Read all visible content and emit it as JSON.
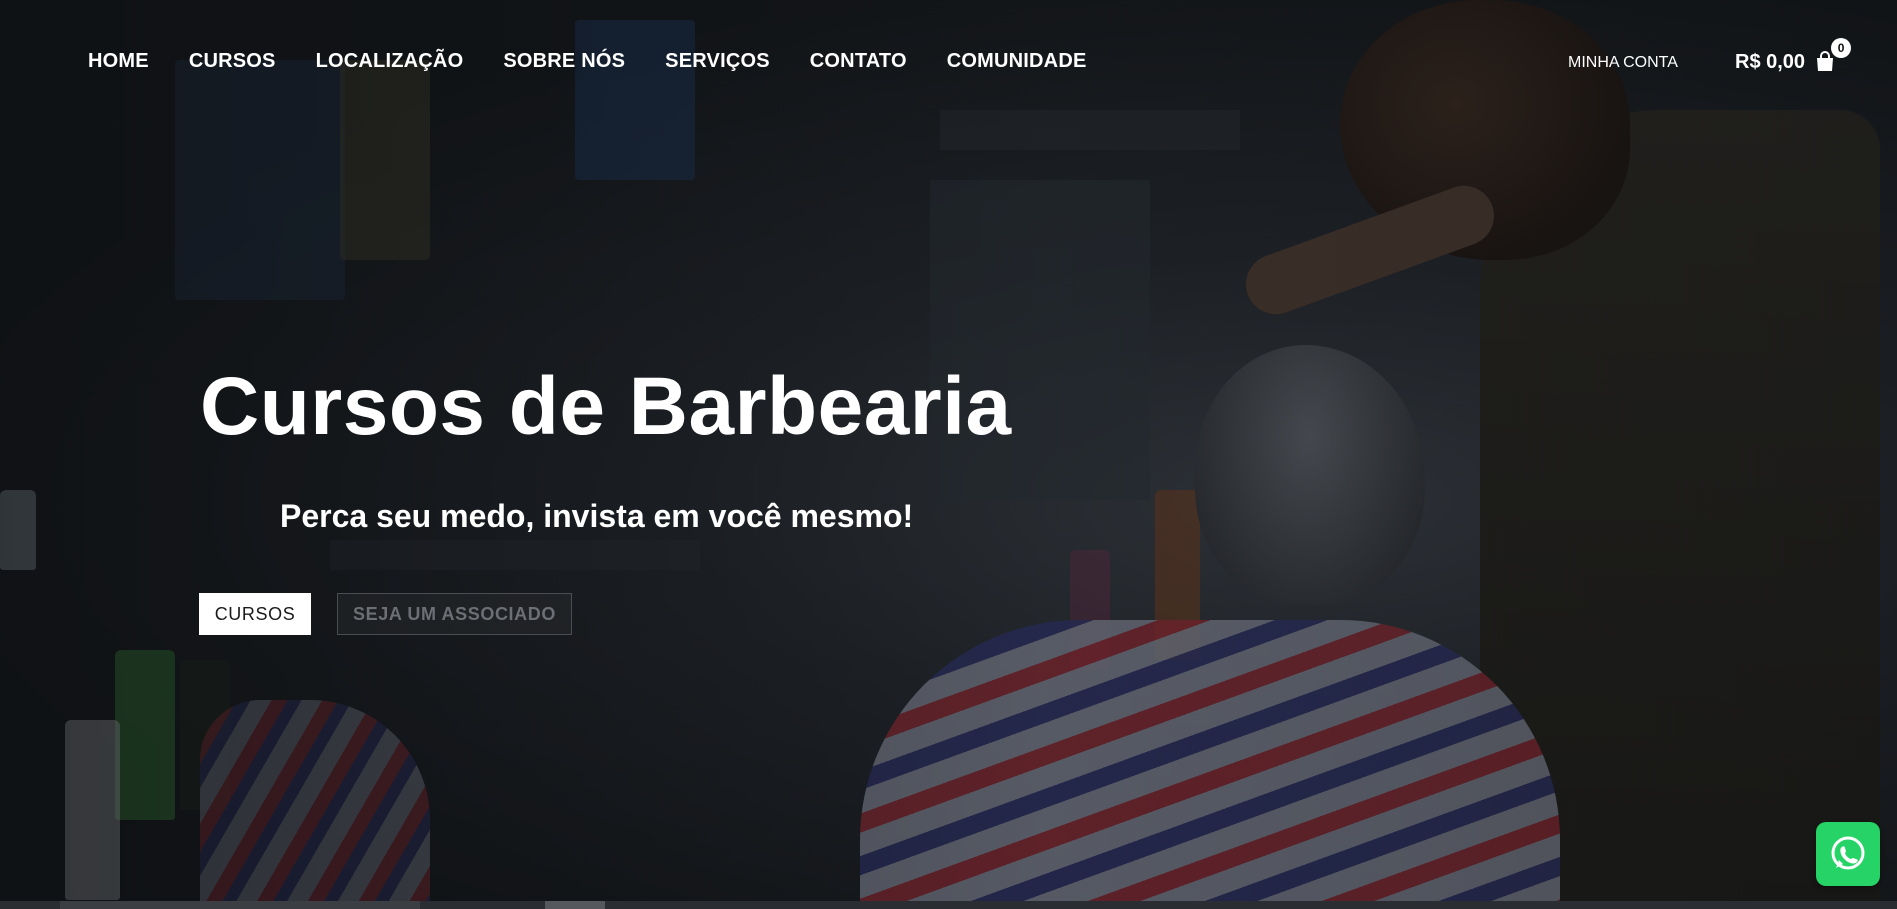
{
  "nav": {
    "items": [
      {
        "label": "HOME"
      },
      {
        "label": "CURSOS"
      },
      {
        "label": "LOCALIZAÇÃO"
      },
      {
        "label": "SOBRE NÓS"
      },
      {
        "label": "SERVIÇOS"
      },
      {
        "label": "CONTATO"
      },
      {
        "label": "COMUNIDADE"
      }
    ],
    "account_label": "MINHA CONTA",
    "cart_total": "R$ 0,00",
    "cart_count": "0",
    "cart_icon": "shopping-bag-icon"
  },
  "hero": {
    "title": "Cursos de Barbearia",
    "subtitle": "Perca seu medo, invista em você mesmo!",
    "primary_button": "CURSOS",
    "secondary_button": "SEJA UM ASSOCIADO"
  },
  "floating": {
    "whatsapp_icon": "whatsapp-icon"
  },
  "colors": {
    "whatsapp": "#25d366",
    "text": "#ffffff",
    "button_bg": "#ffffff"
  }
}
